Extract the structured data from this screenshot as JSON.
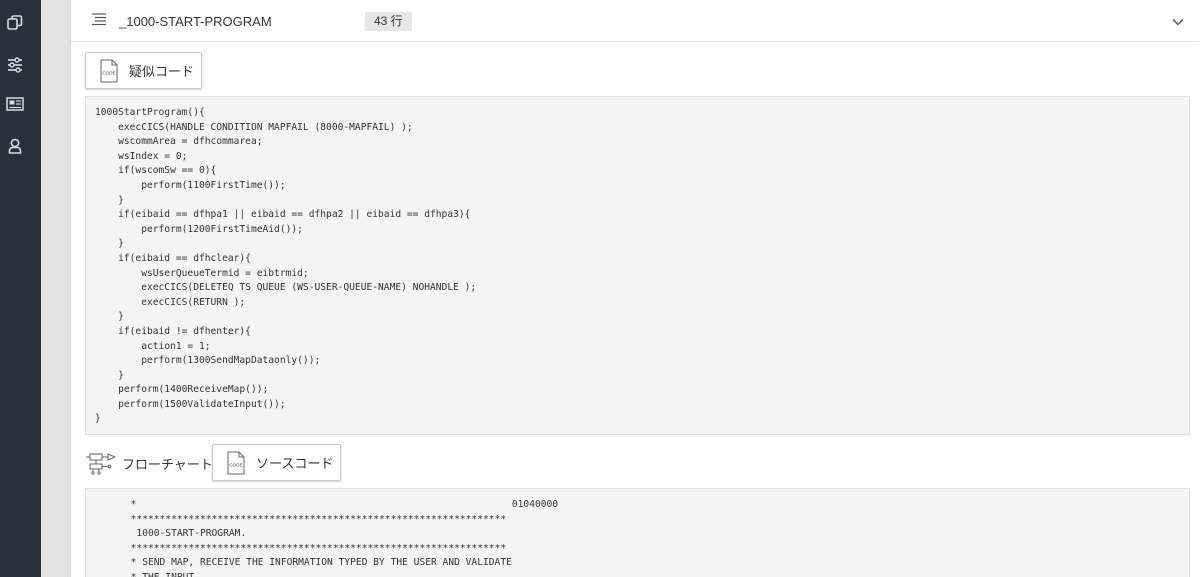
{
  "sidebar": {
    "items": [
      {
        "icon": "copy-icon"
      },
      {
        "icon": "sliders-icon"
      },
      {
        "icon": "newspaper-icon"
      },
      {
        "icon": "user-icon"
      }
    ]
  },
  "header": {
    "title": "_1000-START-PROGRAM",
    "line_count": "43 行"
  },
  "buttons": {
    "pseudo_code": "疑似コード",
    "flowchart": "フローチャート",
    "source_code": "ソースコード",
    "code_icon_text": "CODE"
  },
  "pseudo_code_lines": [
    "1000StartProgram(){",
    "    execCICS(HANDLE CONDITION MAPFAIL (8000-MAPFAIL) );",
    "    wscommArea = dfhcommarea;",
    "    wsIndex = 0;",
    "    if(wscomSw == 0){",
    "        perform(1100FirstTime());",
    "    }",
    "    if(eibaid == dfhpa1 || eibaid == dfhpa2 || eibaid == dfhpa3){",
    "        perform(1200FirstTimeAid());",
    "    }",
    "    if(eibaid == dfhclear){",
    "        wsUserQueueTermid = eibtrmid;",
    "        execCICS(DELETEQ TS QUEUE (WS-USER-QUEUE-NAME) NOHANDLE );",
    "        execCICS(RETURN );",
    "    }",
    "    if(eibaid != dfhenter){",
    "        action1 = 1;",
    "        perform(1300SendMapDataonly());",
    "    }",
    "    perform(1400ReceiveMap());",
    "    perform(1500ValidateInput());",
    "}"
  ],
  "source_code_lines": [
    "      *                                                                 01040000",
    "      *****************************************************************",
    "       1000-START-PROGRAM.",
    "      *****************************************************************",
    "      * SEND MAP, RECEIVE THE INFORMATION TYPED BY THE USER AND VALIDATE",
    "      * THE INPUT"
  ]
}
